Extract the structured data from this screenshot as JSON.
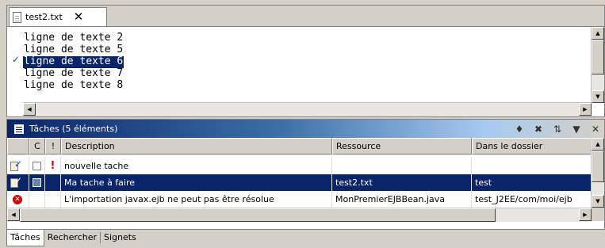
{
  "editor": {
    "tab_label": "test2.txt",
    "close_glyph": "✕",
    "lines": [
      {
        "text": "ligne de texte 2",
        "selected": false
      },
      {
        "text": "ligne de texte 5",
        "selected": false
      },
      {
        "text": "ligne de texte 6",
        "selected": true
      },
      {
        "text": "ligne de texte 7",
        "selected": false
      },
      {
        "text": "ligne de texte 8",
        "selected": false
      }
    ],
    "ruler_marker_line": 3
  },
  "tasks": {
    "title": "Tâches (5 éléments)",
    "toolbar_icons": [
      "filter-icon",
      "delete-completed-icon",
      "sort-icon",
      "view-menu-icon",
      "close-icon"
    ],
    "columns": {
      "icon": "",
      "completed": "C",
      "priority": "!",
      "description": "Description",
      "resource": "Ressource",
      "folder": "Dans le dossier"
    },
    "rows": [
      {
        "type": "task",
        "completed": false,
        "priority": "!",
        "description": "nouvelle tache",
        "resource": "",
        "folder": "",
        "selected": false
      },
      {
        "type": "task",
        "completed": false,
        "priority": "",
        "description": "Ma tache à faire",
        "resource": "test2.txt",
        "folder": "test",
        "selected": true
      },
      {
        "type": "error",
        "completed": null,
        "priority": "",
        "description": "L'importation javax.ejb ne peut pas être résolue",
        "resource": "MonPremierEJBBean.java",
        "folder": "test_J2EE/com/moi/ejb",
        "selected": false
      }
    ]
  },
  "bottom_tabs": [
    {
      "label": "Tâches",
      "active": true
    },
    {
      "label": "Rechercher",
      "active": false
    },
    {
      "label": "Signets",
      "active": false
    }
  ]
}
